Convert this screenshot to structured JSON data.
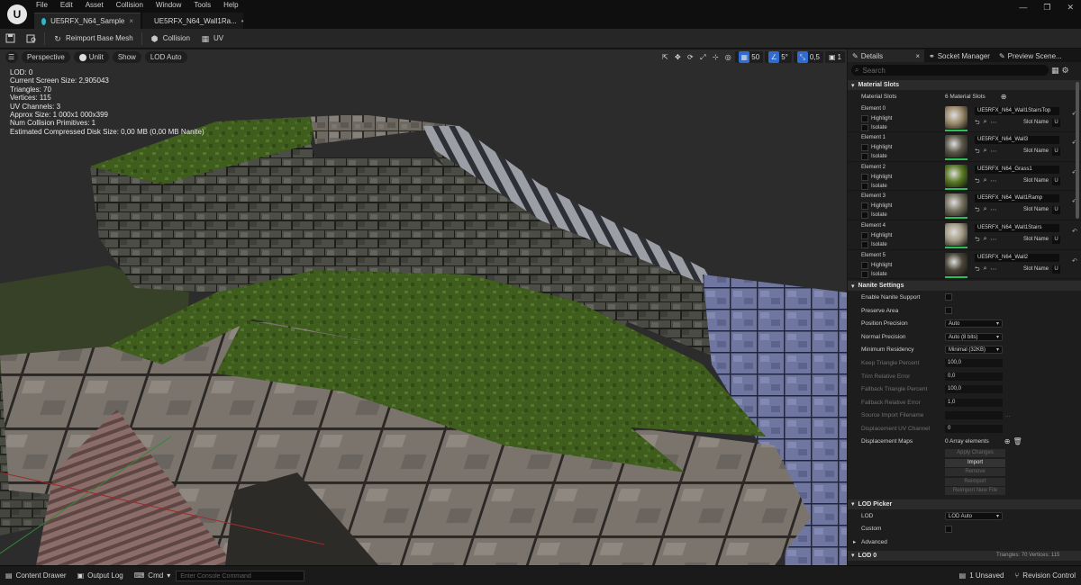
{
  "app": {
    "logo_glyph": "U",
    "menu": [
      "File",
      "Edit",
      "Asset",
      "Collision",
      "Window",
      "Tools",
      "Help"
    ],
    "tabs": [
      {
        "label": "UE5RFX_N64_Sample",
        "dot_color": "#2fb6c8",
        "close": "×"
      },
      {
        "label": "UE5RFX_N64_Wall1Ra...",
        "dot_color": "#3bbf4d",
        "close": "•"
      }
    ],
    "window_controls": [
      "—",
      "❐",
      "✕"
    ]
  },
  "toolbar": {
    "save_icon": "floppy-icon",
    "browse_icon": "browse-icon",
    "reimport_label": "Reimport Base Mesh",
    "collision_label": "Collision",
    "uv_label": "UV"
  },
  "viewport": {
    "menu_glyph": "☰",
    "perspective_label": "Perspective",
    "unlit_label": "Unlit",
    "show_label": "Show",
    "lod_label": "LOD Auto",
    "grid_snap": "50",
    "rot_snap": "5°",
    "scale_snap": "0,5",
    "cam_speed": "1",
    "stats": [
      "LOD:  0",
      "Current Screen Size:  2,905043",
      "Triangles:  70",
      "Vertices:  115",
      "UV Channels:  3",
      "Approx Size: 1 000x1 000x399",
      "Num Collision Primitives:  1",
      "Estimated Compressed Disk Size: 0,00 MB (0,00 MB Nanite)"
    ]
  },
  "details": {
    "tabs": [
      {
        "label": "Details",
        "close": "×"
      },
      {
        "label": "Socket Manager",
        "close": "×"
      },
      {
        "label": "Preview Scene...",
        "close": ""
      }
    ],
    "search_placeholder": "Search",
    "material_section": {
      "title": "Material Slots",
      "slots_label": "Material Slots",
      "slots_count": "6 Material Slots",
      "highlight_label": "Highlight",
      "isolate_label": "Isolate",
      "slot_name_label": "Slot Name",
      "u_label": "U",
      "elements": [
        {
          "label": "Element 0",
          "name": "UE5RFX_N64_Wall1StairsTop",
          "color": "#9b8a6b"
        },
        {
          "label": "Element 1",
          "name": "UE5RFX_N64_Wall3",
          "color": "#5b5648"
        },
        {
          "label": "Element 2",
          "name": "UE5RFX_N64_Grass1",
          "color": "#5a7a22"
        },
        {
          "label": "Element 3",
          "name": "UE5RFX_N64_Wall1Ramp",
          "color": "#77715e"
        },
        {
          "label": "Element 4",
          "name": "UE5RFX_N64_Wall1Stairs",
          "color": "#a49a84"
        },
        {
          "label": "Element 5",
          "name": "UE5RFX_N64_Wall2",
          "color": "#4a4536"
        }
      ]
    },
    "nanite_section": {
      "title": "Nanite Settings",
      "enable_label": "Enable Nanite Support",
      "preserve_label": "Preserve Area",
      "position_label": "Position Precision",
      "position_value": "Auto",
      "normal_label": "Normal Precision",
      "normal_value": "Auto (8 bits)",
      "residency_label": "Minimum Residency",
      "residency_value": "Minimal (32KB)",
      "keep_tri_label": "Keep Triangle Percent",
      "keep_tri_value": "100,0",
      "trim_label": "Trim Relative Error",
      "trim_value": "0,0",
      "fallback_tri_label": "Fallback Triangle Percent",
      "fallback_tri_value": "100,0",
      "fallback_rel_label": "Fallback Relative Error",
      "fallback_rel_value": "1,0",
      "source_import_label": "Source Import Filename",
      "source_import_dots": "...",
      "disp_uv_label": "Displacement UV Channel",
      "disp_uv_value": "0",
      "disp_maps_label": "Displacement Maps",
      "disp_maps_value": "0 Array elements",
      "buttons": [
        "Apply Changes",
        "Import",
        "Remove",
        "Reimport",
        "Reimport New File"
      ]
    },
    "lod_section": {
      "title": "LOD Picker",
      "lod_label": "LOD",
      "lod_value": "LOD Auto",
      "custom_label": "Custom",
      "advanced_label": "Advanced"
    },
    "lod0_section": {
      "title": "LOD 0",
      "summary": "Triangles: 70   Vertices: 115"
    }
  },
  "statusbar": {
    "content_drawer": "Content Drawer",
    "output_log": "Output Log",
    "cmd_label": "Cmd",
    "console_placeholder": "Enter Console Command",
    "unsaved": "1 Unsaved",
    "revision": "Revision Control"
  }
}
